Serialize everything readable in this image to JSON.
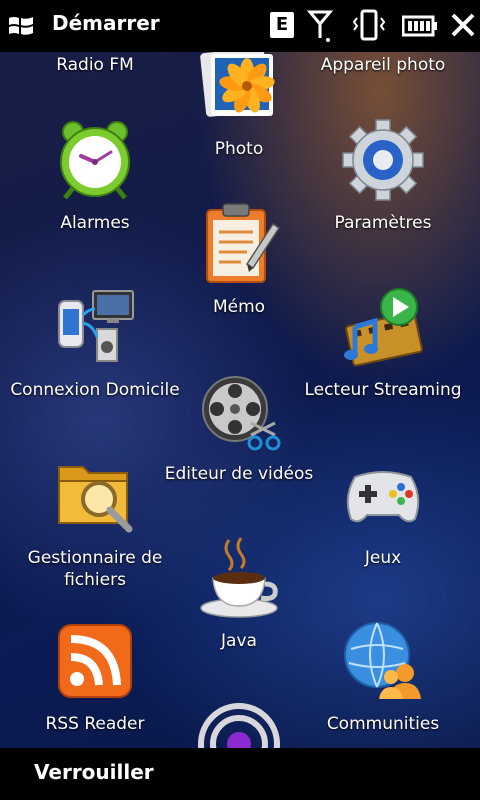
{
  "header": {
    "title": "Démarrer",
    "network_badge": "E"
  },
  "softkeys": {
    "left": "Verrouiller"
  },
  "programs": [
    {
      "label": "Radio FM"
    },
    {
      "label": "Photo"
    },
    {
      "label": "Appareil photo"
    },
    {
      "label": "Alarmes"
    },
    {
      "label": "Mémo"
    },
    {
      "label": "Paramètres"
    },
    {
      "label": "Connexion Domicile"
    },
    {
      "label": "Editeur de vidéos"
    },
    {
      "label": "Lecteur Streaming"
    },
    {
      "label": "Gestionnaire de fichiers"
    },
    {
      "label": "Java"
    },
    {
      "label": "Jeux"
    },
    {
      "label": "RSS Reader"
    },
    {
      "label": "Communities"
    }
  ]
}
